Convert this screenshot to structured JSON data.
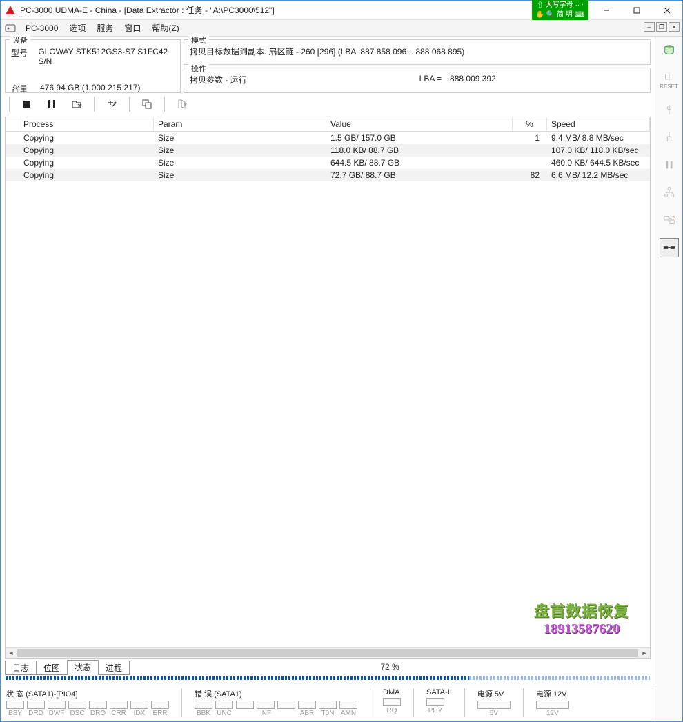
{
  "titlebar": {
    "title": "PC-3000 UDMA-E - China - [Data Extractor : 任务 - \"A:\\PC3000\\512\"]",
    "ime_top": "⇧ 大写字母  ·· ⸱",
    "ime_bottom": "✋ 🔍 简 明 ⌨"
  },
  "menu": {
    "app": "PC-3000",
    "items": [
      "选项",
      "服务",
      "窗口",
      "帮助(Z)"
    ]
  },
  "device": {
    "legend": "设备",
    "model_label": "型号",
    "model_value": "GLOWAY STK512GS3-S7 S1FC42 S/N",
    "capacity_label": "容量",
    "capacity_value": "476.94 GB (1 000 215 217)"
  },
  "mode": {
    "legend": "模式",
    "text": "拷贝目标数据到副本. 扇区链 - 260 [296] (LBA :887 858 096 .. 888 068 895)"
  },
  "operation": {
    "legend": "操作",
    "status": "拷贝参数 - 运行",
    "lba_label": "LBA =",
    "lba_value": "888 009 392"
  },
  "table": {
    "headers": {
      "process": "Process",
      "param": "Param",
      "value": "Value",
      "pct": "%",
      "speed": "Speed"
    },
    "rows": [
      {
        "process": "Copying",
        "param": "Size",
        "value": "1.5 GB/ 157.0 GB",
        "pct": "1",
        "speed": "9.4 MB/ 8.8 MB/sec"
      },
      {
        "process": "Copying",
        "param": "Size",
        "value": "118.0 KB/ 88.7 GB",
        "pct": "",
        "speed": "107.0 KB/ 118.0 KB/sec"
      },
      {
        "process": "Copying",
        "param": "Size",
        "value": "644.5 KB/ 88.7 GB",
        "pct": "",
        "speed": "460.0 KB/ 644.5 KB/sec"
      },
      {
        "process": "Copying",
        "param": "Size",
        "value": "72.7 GB/ 88.7 GB",
        "pct": "82",
        "speed": "6.6 MB/ 12.2 MB/sec"
      }
    ]
  },
  "watermark": {
    "line1": "盘首数据恢复",
    "line2": "18913587620"
  },
  "tabs": {
    "items": [
      "日志",
      "位图",
      "状态",
      "进程"
    ],
    "active_index": 2
  },
  "progress": {
    "label": "72 %",
    "percent": 72
  },
  "side_tools": {
    "reset_label": "RESET"
  },
  "status": {
    "sata1": {
      "label": "状 态 (SATA1)-[PIO4]",
      "bits": [
        "BSY",
        "DRD",
        "DWF",
        "DSC",
        "DRQ",
        "CRR",
        "IDX",
        "ERR"
      ]
    },
    "err": {
      "label": "错 误 (SATA1)",
      "bits": [
        "BBK",
        "UNC",
        "",
        "INF",
        "",
        "ABR",
        "T0N",
        "AMN"
      ]
    },
    "dma": {
      "label": "DMA",
      "bits": [
        "RQ"
      ]
    },
    "sata2": {
      "label": "SATA-II",
      "bits": [
        "PHY"
      ]
    },
    "p5": {
      "label": "电源 5V",
      "bits": [
        "5V"
      ]
    },
    "p12": {
      "label": "电源 12V",
      "bits": [
        "12V"
      ]
    }
  }
}
